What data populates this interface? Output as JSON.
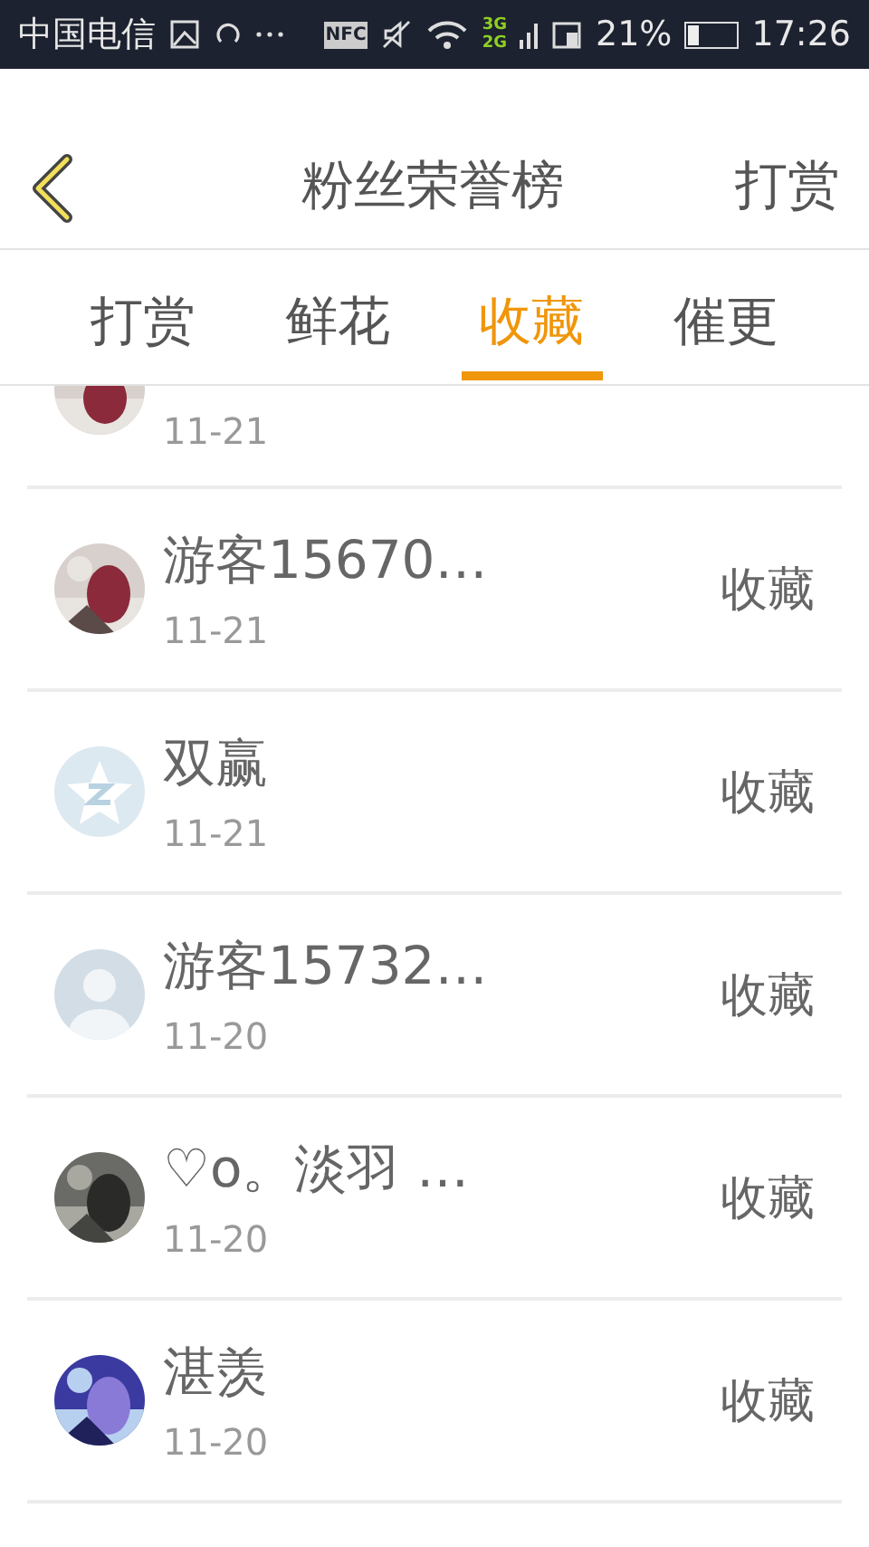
{
  "status_bar": {
    "carrier": "中国电信",
    "nfc": "NFC",
    "network_top": "3G",
    "network_bottom": "2G",
    "battery_percent": "21%",
    "time": "17:26"
  },
  "header": {
    "title": "粉丝荣誉榜",
    "action": "打赏"
  },
  "tabs": [
    {
      "label": "打赏",
      "selected": false
    },
    {
      "label": "鲜花",
      "selected": false
    },
    {
      "label": "收藏",
      "selected": true
    },
    {
      "label": "催更",
      "selected": false
    }
  ],
  "cut_row": {
    "date": "11-21"
  },
  "rows": [
    {
      "name": "游客15670…",
      "date": "11-21",
      "action": "收藏"
    },
    {
      "kind": "logo",
      "name": "双赢",
      "date": "11-21",
      "action": "收藏"
    },
    {
      "kind": "default",
      "name": "游客15732…",
      "date": "11-20",
      "action": "收藏"
    },
    {
      "name": "♡o。淡羽 …",
      "date": "11-20",
      "action": "收藏"
    },
    {
      "name": "湛羡",
      "date": "11-20",
      "action": "收藏"
    }
  ]
}
